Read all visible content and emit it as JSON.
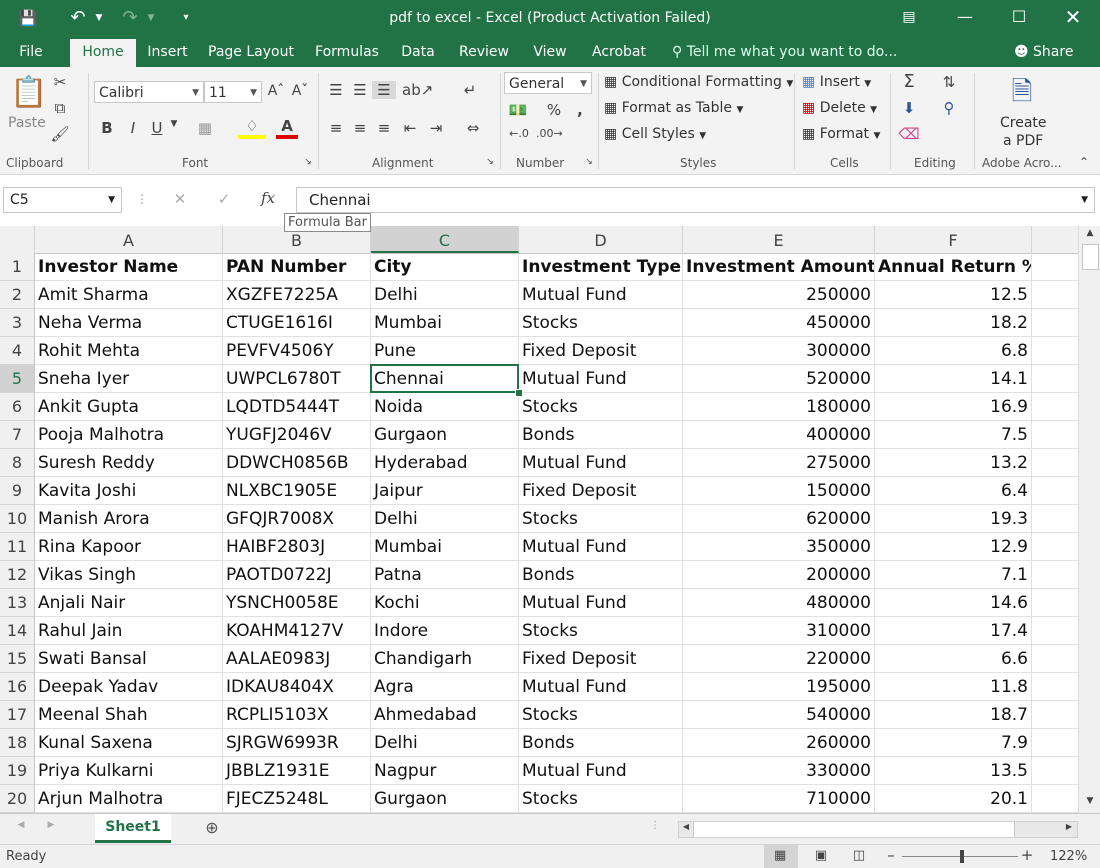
{
  "title": "pdf to excel - Excel (Product Activation Failed)",
  "ribbon_tabs": [
    "File",
    "Home",
    "Insert",
    "Page Layout",
    "Formulas",
    "Data",
    "Review",
    "View",
    "Acrobat"
  ],
  "tell_me": "Tell me what you want to do...",
  "share": "Share",
  "clipboard": {
    "paste": "Paste",
    "label": "Clipboard"
  },
  "font": {
    "name": "Calibri",
    "size": "11",
    "label": "Font",
    "bold": "B",
    "italic": "I",
    "underline": "U",
    "font_color": "A"
  },
  "alignment": {
    "label": "Alignment"
  },
  "number": {
    "format": "General",
    "percent": "%",
    "comma": ",",
    "label": "Number"
  },
  "styles": {
    "conditional": "Conditional Formatting",
    "format_table": "Format as Table",
    "cell_styles": "Cell Styles",
    "label": "Styles"
  },
  "cells": {
    "insert": "Insert",
    "delete": "Delete",
    "format": "Format",
    "label": "Cells"
  },
  "editing": {
    "label": "Editing"
  },
  "adobe": {
    "create": "Create",
    "pdf": "a PDF",
    "label": "Adobe Acro..."
  },
  "formula_bar": {
    "name_box": "C5",
    "value": "Chennai",
    "tooltip": "Formula Bar",
    "fx": "fx"
  },
  "columns": [
    "A",
    "B",
    "C",
    "D",
    "E",
    "F"
  ],
  "selected_column": "C",
  "selected_row": 5,
  "rows": [
    {
      "n": "1",
      "c": [
        "Investor Name",
        "PAN Number",
        "City",
        "Investment Type",
        "Investment Amount",
        "Annual Return %"
      ]
    },
    {
      "n": "2",
      "c": [
        "Amit Sharma",
        "XGZFE7225A",
        "Delhi",
        "Mutual Fund",
        "250000",
        "12.5"
      ]
    },
    {
      "n": "3",
      "c": [
        "Neha Verma",
        "CTUGE1616I",
        "Mumbai",
        "Stocks",
        "450000",
        "18.2"
      ]
    },
    {
      "n": "4",
      "c": [
        "Rohit Mehta",
        "PEVFV4506Y",
        "Pune",
        "Fixed Deposit",
        "300000",
        "6.8"
      ]
    },
    {
      "n": "5",
      "c": [
        "Sneha Iyer",
        "UWPCL6780T",
        "Chennai",
        "Mutual Fund",
        "520000",
        "14.1"
      ]
    },
    {
      "n": "6",
      "c": [
        "Ankit Gupta",
        "LQDTD5444T",
        "Noida",
        "Stocks",
        "180000",
        "16.9"
      ]
    },
    {
      "n": "7",
      "c": [
        "Pooja Malhotra",
        "YUGFJ2046V",
        "Gurgaon",
        "Bonds",
        "400000",
        "7.5"
      ]
    },
    {
      "n": "8",
      "c": [
        "Suresh Reddy",
        "DDWCH0856B",
        "Hyderabad",
        "Mutual Fund",
        "275000",
        "13.2"
      ]
    },
    {
      "n": "9",
      "c": [
        "Kavita Joshi",
        "NLXBC1905E",
        "Jaipur",
        "Fixed Deposit",
        "150000",
        "6.4"
      ]
    },
    {
      "n": "10",
      "c": [
        "Manish Arora",
        "GFQJR7008X",
        "Delhi",
        "Stocks",
        "620000",
        "19.3"
      ]
    },
    {
      "n": "11",
      "c": [
        "Rina Kapoor",
        "HAIBF2803J",
        "Mumbai",
        "Mutual Fund",
        "350000",
        "12.9"
      ]
    },
    {
      "n": "12",
      "c": [
        "Vikas Singh",
        "PAOTD0722J",
        "Patna",
        "Bonds",
        "200000",
        "7.1"
      ]
    },
    {
      "n": "13",
      "c": [
        "Anjali Nair",
        "YSNCH0058E",
        "Kochi",
        "Mutual Fund",
        "480000",
        "14.6"
      ]
    },
    {
      "n": "14",
      "c": [
        "Rahul Jain",
        "KOAHM4127V",
        "Indore",
        "Stocks",
        "310000",
        "17.4"
      ]
    },
    {
      "n": "15",
      "c": [
        "Swati Bansal",
        "AALAE0983J",
        "Chandigarh",
        "Fixed Deposit",
        "220000",
        "6.6"
      ]
    },
    {
      "n": "16",
      "c": [
        "Deepak Yadav",
        "IDKAU8404X",
        "Agra",
        "Mutual Fund",
        "195000",
        "11.8"
      ]
    },
    {
      "n": "17",
      "c": [
        "Meenal Shah",
        "RCPLI5103X",
        "Ahmedabad",
        "Stocks",
        "540000",
        "18.7"
      ]
    },
    {
      "n": "18",
      "c": [
        "Kunal Saxena",
        "SJRGW6993R",
        "Delhi",
        "Bonds",
        "260000",
        "7.9"
      ]
    },
    {
      "n": "19",
      "c": [
        "Priya Kulkarni",
        "JBBLZ1931E",
        "Nagpur",
        "Mutual Fund",
        "330000",
        "13.5"
      ]
    },
    {
      "n": "20",
      "c": [
        "Arjun Malhotra",
        "FJECZ5248L",
        "Gurgaon",
        "Stocks",
        "710000",
        "20.1"
      ]
    }
  ],
  "sheet_tab": "Sheet1",
  "status": "Ready",
  "zoom": "122%"
}
